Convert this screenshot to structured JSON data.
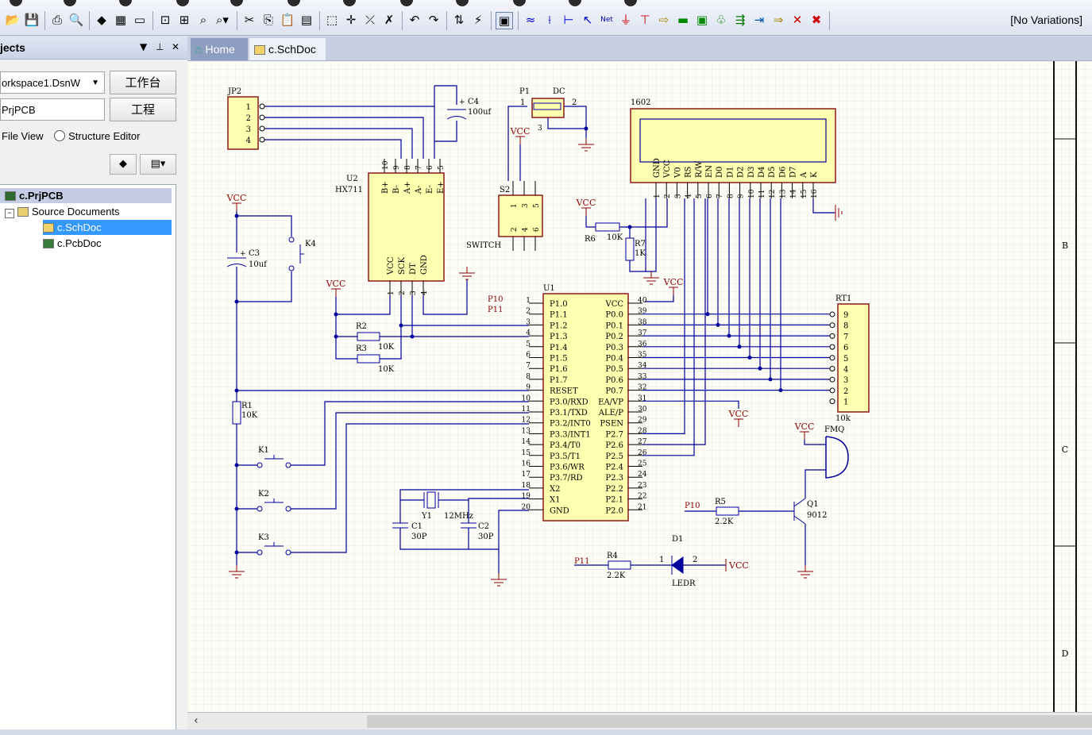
{
  "toolbar": {
    "variations_label": "[No Variations]"
  },
  "panel": {
    "title": "jects",
    "workspace_value": "orkspace1.DsnW",
    "workspace_button": "工作台",
    "project_value": "PrjPCB",
    "project_button": "工程",
    "view_file_label": "File View",
    "view_structure_label": "Structure Editor",
    "tree": {
      "project": "c.PrjPCB",
      "folder": "Source Documents",
      "files": [
        "c.SchDoc",
        "c.PcbDoc"
      ]
    }
  },
  "tabs": {
    "home": "Home",
    "doc": "c.SchDoc"
  },
  "schematic": {
    "border_zones": [
      "B",
      "C",
      "D"
    ],
    "parts": {
      "jp2": {
        "ref": "JP2",
        "pins": [
          "1",
          "2",
          "3",
          "4"
        ]
      },
      "c4": {
        "ref": "C4",
        "value": "100uf"
      },
      "p1": {
        "ref": "P1",
        "value": "DC",
        "pins": [
          "1",
          "2",
          "3"
        ]
      },
      "lcd": {
        "ref": "1602",
        "pins": [
          "GND",
          "VCC",
          "V0",
          "RS",
          "R/W",
          "EN",
          "D0",
          "D1",
          "D2",
          "D3",
          "D4",
          "D5",
          "D6",
          "D7",
          "A",
          "K"
        ],
        "pin_numbers": [
          "1",
          "2",
          "3",
          "4",
          "5",
          "6",
          "7",
          "8",
          "9",
          "10",
          "11",
          "12",
          "13",
          "14",
          "15",
          "16"
        ]
      },
      "u2": {
        "ref": "U2",
        "value": "HX711",
        "top_pins": [
          "B+",
          "B-",
          "A+",
          "A-",
          "E-",
          "E+"
        ],
        "top_nums": [
          "10",
          "9",
          "8",
          "7",
          "6",
          "5"
        ],
        "bottom_pins": [
          "VCC",
          "SCK",
          "DT",
          "GND"
        ],
        "bottom_nums": [
          "1",
          "2",
          "3",
          "4"
        ]
      },
      "s2": {
        "ref": "S2",
        "value": "SWITCH",
        "pin_nums": [
          "1",
          "3",
          "5",
          "2",
          "4",
          "6"
        ]
      },
      "c3": {
        "ref": "C3",
        "value": "10uf"
      },
      "k4": {
        "ref": "K4"
      },
      "r6": {
        "ref": "R6",
        "value": "10K"
      },
      "r7": {
        "ref": "R7",
        "value": "1K"
      },
      "r2": {
        "ref": "R2",
        "value": "10K"
      },
      "r3": {
        "ref": "R3",
        "value": "10K"
      },
      "r1": {
        "ref": "R1",
        "value": "10K"
      },
      "u1": {
        "ref": "U1",
        "left_pins": [
          "P1.0",
          "P1.1",
          "P1.2",
          "P1.3",
          "P1.4",
          "P1.5",
          "P1.6",
          "P1.7",
          "RESET",
          "P3.0/RXD",
          "P3.1/TXD",
          "P3.2/INT0",
          "P3.3/INT1",
          "P3.4/T0",
          "P3.5/T1",
          "P3.6/WR",
          "P3.7/RD",
          "X2",
          "X1",
          "GND"
        ],
        "left_nums": [
          "1",
          "2",
          "3",
          "4",
          "5",
          "6",
          "7",
          "8",
          "9",
          "10",
          "11",
          "12",
          "13",
          "14",
          "15",
          "16",
          "17",
          "18",
          "19",
          "20"
        ],
        "right_pins": [
          "VCC",
          "P0.0",
          "P0.1",
          "P0.2",
          "P0.3",
          "P0.4",
          "P0.5",
          "P0.6",
          "P0.7",
          "EA/VP",
          "ALE/P",
          "PSEN",
          "P2.7",
          "P2.6",
          "P2.5",
          "P2.4",
          "P2.3",
          "P2.2",
          "P2.1",
          "P2.0"
        ],
        "right_nums": [
          "40",
          "39",
          "38",
          "37",
          "36",
          "35",
          "34",
          "33",
          "32",
          "31",
          "30",
          "29",
          "28",
          "27",
          "26",
          "25",
          "24",
          "23",
          "22",
          "21"
        ]
      },
      "rt1": {
        "ref": "RT1",
        "value": "10k",
        "pins": [
          "9",
          "8",
          "7",
          "6",
          "5",
          "4",
          "3",
          "2",
          "1"
        ]
      },
      "k1": {
        "ref": "K1"
      },
      "k2": {
        "ref": "K2"
      },
      "k3": {
        "ref": "K3"
      },
      "y1": {
        "ref": "Y1",
        "value": "12MHz"
      },
      "c1": {
        "ref": "C1",
        "value": "30P"
      },
      "c2": {
        "ref": "C2",
        "value": "30P"
      },
      "r5": {
        "ref": "R5",
        "value": "2.2K"
      },
      "q1": {
        "ref": "Q1",
        "value": "9012"
      },
      "fmq": {
        "ref": "FMQ"
      },
      "r4": {
        "ref": "R4",
        "value": "2.2K"
      },
      "d1": {
        "ref": "D1",
        "value": "LEDR",
        "pin1": "1",
        "pin2": "2"
      }
    },
    "nets": {
      "vcc": "VCC",
      "p10": "P10",
      "p11": "P11"
    }
  }
}
